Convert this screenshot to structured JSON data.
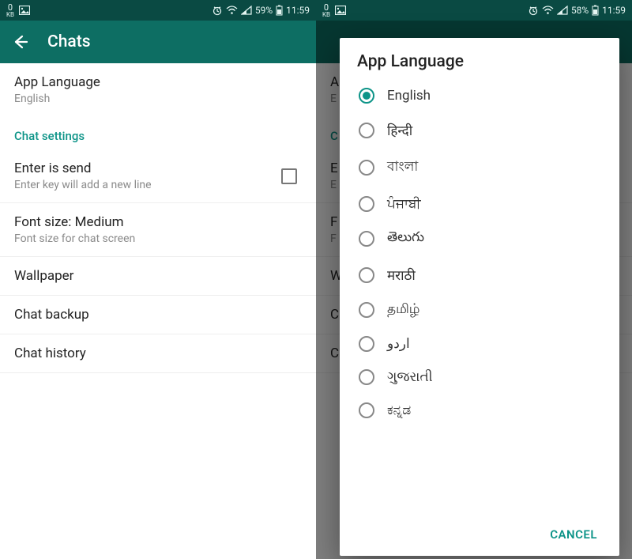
{
  "left": {
    "statusbar": {
      "kb": "0",
      "kb_unit": "KB",
      "battery": "59%",
      "time": "11:59"
    },
    "appbar": {
      "title": "Chats"
    },
    "rows": {
      "app_language": {
        "primary": "App Language",
        "secondary": "English"
      },
      "section_chat_settings": "Chat settings",
      "enter_send": {
        "primary": "Enter is send",
        "secondary": "Enter key will add a new line"
      },
      "font_size": {
        "primary": "Font size: Medium",
        "secondary": "Font size for chat screen"
      },
      "wallpaper": {
        "primary": "Wallpaper"
      },
      "backup": {
        "primary": "Chat backup"
      },
      "history": {
        "primary": "Chat history"
      }
    }
  },
  "right": {
    "statusbar": {
      "kb": "0",
      "kb_unit": "KB",
      "battery": "58%",
      "time": "11:59"
    },
    "modal": {
      "title": "App Language",
      "languages": [
        "English",
        "हिन्दी",
        "বাংলা",
        "ਪੰਜਾਬੀ",
        "తెలుగు",
        "मराठी",
        "தமிழ்",
        "اردو",
        "ગુજરાતી",
        "ಕನ್ನಡ"
      ],
      "selected_index": 0,
      "cancel": "CANCEL"
    }
  }
}
